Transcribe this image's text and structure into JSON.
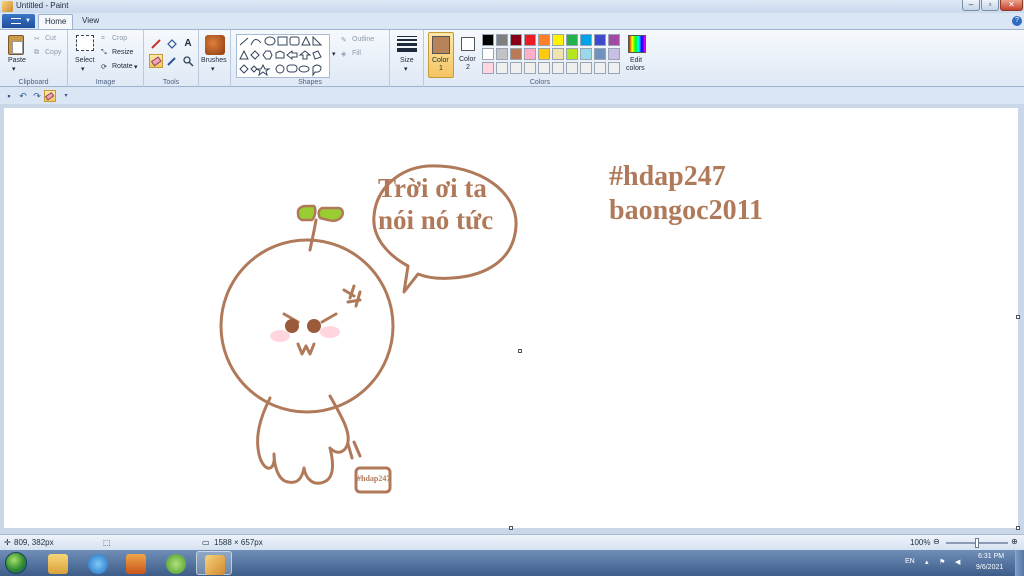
{
  "window": {
    "title": "Untitled - Paint"
  },
  "tabs": {
    "home": "Home",
    "view": "View"
  },
  "clipboard": {
    "paste": "Paste",
    "cut": "Cut",
    "copy": "Copy",
    "label": "Clipboard"
  },
  "image": {
    "select": "Select",
    "crop": "Crop",
    "resize": "Resize",
    "rotate": "Rotate",
    "label": "Image"
  },
  "tools": {
    "label": "Tools"
  },
  "brushes": {
    "label": "Brushes"
  },
  "shapes": {
    "outline": "Outline",
    "fill": "Fill",
    "label": "Shapes"
  },
  "size": {
    "label": "Size"
  },
  "colors": {
    "color1_line1": "Color",
    "color1_line2": "1",
    "color2_line1": "Color",
    "color2_line2": "2",
    "edit_line1": "Edit",
    "edit_line2": "colors",
    "label": "Colors",
    "color1_value": "#b9835a",
    "color2_value": "#ffffff",
    "palette_row1": [
      "#000000",
      "#7f7f7f",
      "#880015",
      "#ed1c24",
      "#ff7f27",
      "#fff200",
      "#22b14c",
      "#00a2e8",
      "#3f48cc",
      "#a349a4"
    ],
    "palette_row2": [
      "#ffffff",
      "#c3c3c3",
      "#b97a57",
      "#ffaec9",
      "#ffc90e",
      "#efe4b0",
      "#b5e61d",
      "#99d9ea",
      "#7092be",
      "#c8bfe7"
    ],
    "palette_row3": [
      "#ffd6e0",
      "#f0f0f0",
      "#f0f0f0",
      "#f0f0f0",
      "#f0f0f0",
      "#f0f0f0",
      "#f0f0f0",
      "#f0f0f0",
      "#f0f0f0",
      "#f0f0f0"
    ]
  },
  "canvas": {
    "speech_line1": "Trời ơi ta",
    "speech_line2": "nói nó tức",
    "tag_line1": "#hdap247",
    "tag_line2": "baongoc2011",
    "small_tag": "#hdap247",
    "stroke_color": "#b07a5a",
    "seed_color": "#9acd32"
  },
  "status": {
    "cursor_pos": "809, 382px",
    "canvas_size": "1588 × 657px",
    "zoom": "100%"
  },
  "taskbar": {
    "lang": "EN",
    "time": "6:31 PM",
    "date": "9/6/2021"
  }
}
